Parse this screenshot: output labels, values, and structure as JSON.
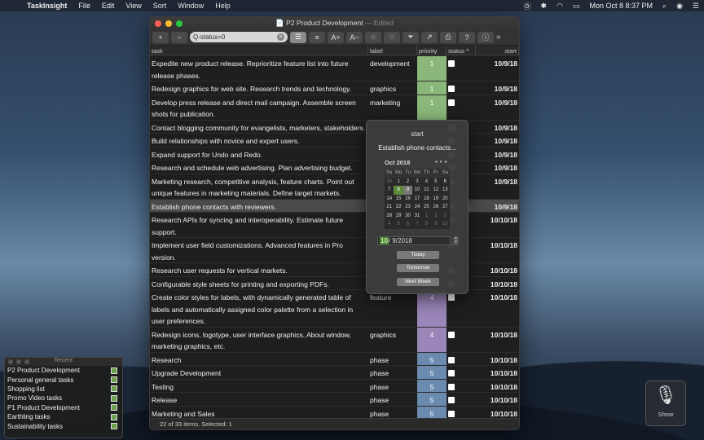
{
  "menubar": {
    "app_name": "TaskInsight",
    "items": [
      "File",
      "Edit",
      "View",
      "Sort",
      "Window",
      "Help"
    ],
    "clock": "Mon Oct 8  8:37 PM"
  },
  "window": {
    "title": "P2 Product Development",
    "edited": "— Edited",
    "search_value": "Q-status=0",
    "columns": {
      "task": "task",
      "label": "label",
      "priority": "priority",
      "status": "status ^",
      "start": "start"
    },
    "status_text": "22 of 33 items. Selected: 1"
  },
  "rows": [
    {
      "task": "Expedite new product release. Reprioritize feature list into future release phases.",
      "label": "development",
      "priority": "1",
      "start": "10/9/18",
      "color": "#8bb87a",
      "lines": 2
    },
    {
      "task": "Redesign graphics for web site. Research trends and technology.",
      "label": "graphics",
      "priority": "1",
      "start": "10/9/18",
      "color": "#8bb87a",
      "lines": 1
    },
    {
      "task": "Develop press release and direct mail campaign. Assemble screen shots for publication.",
      "label": "marketing",
      "priority": "1",
      "start": "10/9/18",
      "color": "#8bb87a",
      "lines": 2
    },
    {
      "task": "Contact blogging community for evangelists, marketers, stakeholders.",
      "label": "",
      "priority": "",
      "start": "10/9/18",
      "color": "",
      "lines": 1
    },
    {
      "task": "Build relationships with novice and expert users.",
      "label": "",
      "priority": "",
      "start": "10/9/18",
      "color": "",
      "lines": 1
    },
    {
      "task": "Expand support for Undo and Redo.",
      "label": "",
      "priority": "",
      "start": "10/9/18",
      "color": "",
      "lines": 1
    },
    {
      "task": "Research and schedule web advertising. Plan advertising budget.",
      "label": "",
      "priority": "",
      "start": "10/9/18",
      "color": "",
      "lines": 1
    },
    {
      "task": "Marketing research, competitive analysis, feature charts. Point out unique features in marketing materials. Define target markets.",
      "label": "",
      "priority": "",
      "start": "10/9/18",
      "color": "",
      "lines": 2
    },
    {
      "task": "Establish phone contacts with reviewers.",
      "label": "",
      "priority": "",
      "start": "10/9/18",
      "color": "",
      "lines": 1,
      "selected": true
    },
    {
      "task": "Research APIs for syncing and interoperability. Estimate future support.",
      "label": "",
      "priority": "",
      "start": "10/10/18",
      "color": "",
      "lines": 2
    },
    {
      "task": "Implement user field customizations. Advanced features in Pro version.",
      "label": "",
      "priority": "",
      "start": "10/10/18",
      "color": "",
      "lines": 2
    },
    {
      "task": "Research user requests for vertical markets.",
      "label": "",
      "priority": "",
      "start": "10/10/18",
      "color": "",
      "lines": 1
    },
    {
      "task": "Configurable style sheets for printing and exporting PDFs.",
      "label": "",
      "priority": "",
      "start": "10/10/18",
      "color": "",
      "lines": 1
    },
    {
      "task": "Create color styles for labels, with dynamically generated table of labels and automatically assigned color palette from a selection in user preferences.",
      "label": "feature",
      "priority": "4",
      "start": "10/10/18",
      "color": "#9a86b8",
      "lines": 3
    },
    {
      "task": "Redesign icons, logotype, user interface graphics, About window, marketing graphics, etc.",
      "label": "graphics",
      "priority": "4",
      "start": "10/10/18",
      "color": "#9a86b8",
      "lines": 2
    },
    {
      "task": "Research",
      "label": "phase",
      "priority": "5",
      "start": "10/10/18",
      "color": "#6a8ab0",
      "lines": 1
    },
    {
      "task": "Upgrade Development",
      "label": "phase",
      "priority": "5",
      "start": "10/10/18",
      "color": "#6a8ab0",
      "lines": 1
    },
    {
      "task": "Testing",
      "label": "phase",
      "priority": "5",
      "start": "10/10/18",
      "color": "#6a8ab0",
      "lines": 1
    },
    {
      "task": "Release",
      "label": "phase",
      "priority": "5",
      "start": "10/10/18",
      "color": "#6a8ab0",
      "lines": 1
    },
    {
      "task": "Marketing and Sales",
      "label": "phase",
      "priority": "5",
      "start": "10/10/18",
      "color": "#6a8ab0",
      "lines": 1
    }
  ],
  "popover": {
    "title": "start",
    "task": "Establish phone contacts...",
    "month": "Oct 2018",
    "dows": [
      "Su",
      "Mo",
      "Tu",
      "We",
      "Th",
      "Fr",
      "Sa"
    ],
    "days": [
      [
        "30",
        "dim"
      ],
      [
        "1",
        ""
      ],
      [
        "2",
        ""
      ],
      [
        "3",
        ""
      ],
      [
        "4",
        ""
      ],
      [
        "5",
        ""
      ],
      [
        "6",
        ""
      ],
      [
        "7",
        ""
      ],
      [
        "8",
        "today"
      ],
      [
        "9",
        "selday"
      ],
      [
        "10",
        ""
      ],
      [
        "11",
        ""
      ],
      [
        "12",
        ""
      ],
      [
        "13",
        ""
      ],
      [
        "14",
        ""
      ],
      [
        "15",
        ""
      ],
      [
        "16",
        ""
      ],
      [
        "17",
        ""
      ],
      [
        "18",
        ""
      ],
      [
        "19",
        ""
      ],
      [
        "20",
        ""
      ],
      [
        "21",
        ""
      ],
      [
        "22",
        ""
      ],
      [
        "23",
        ""
      ],
      [
        "24",
        ""
      ],
      [
        "25",
        ""
      ],
      [
        "26",
        ""
      ],
      [
        "27",
        ""
      ],
      [
        "28",
        ""
      ],
      [
        "29",
        ""
      ],
      [
        "30",
        ""
      ],
      [
        "31",
        ""
      ],
      [
        "1",
        "dim"
      ],
      [
        "2",
        "dim"
      ],
      [
        "3",
        "dim"
      ],
      [
        "4",
        "dim"
      ],
      [
        "5",
        "dim"
      ],
      [
        "6",
        "dim"
      ],
      [
        "7",
        "dim"
      ],
      [
        "8",
        "dim"
      ],
      [
        "9",
        "dim"
      ],
      [
        "10",
        "dim"
      ]
    ],
    "date_hl": "10",
    "date_rest": "/  9/2018",
    "btn_today": "Today",
    "btn_tomorrow": "Tomorrow",
    "btn_next_week": "Next Week"
  },
  "recent": {
    "title": "Recent",
    "items": [
      "P2 Product Development",
      "Personal general tasks",
      "Shopping list",
      "Promo Video tasks",
      "P1 Product Development",
      "Earthling tasks",
      "Sustainability tasks"
    ]
  },
  "dictation": {
    "label": "Show"
  }
}
